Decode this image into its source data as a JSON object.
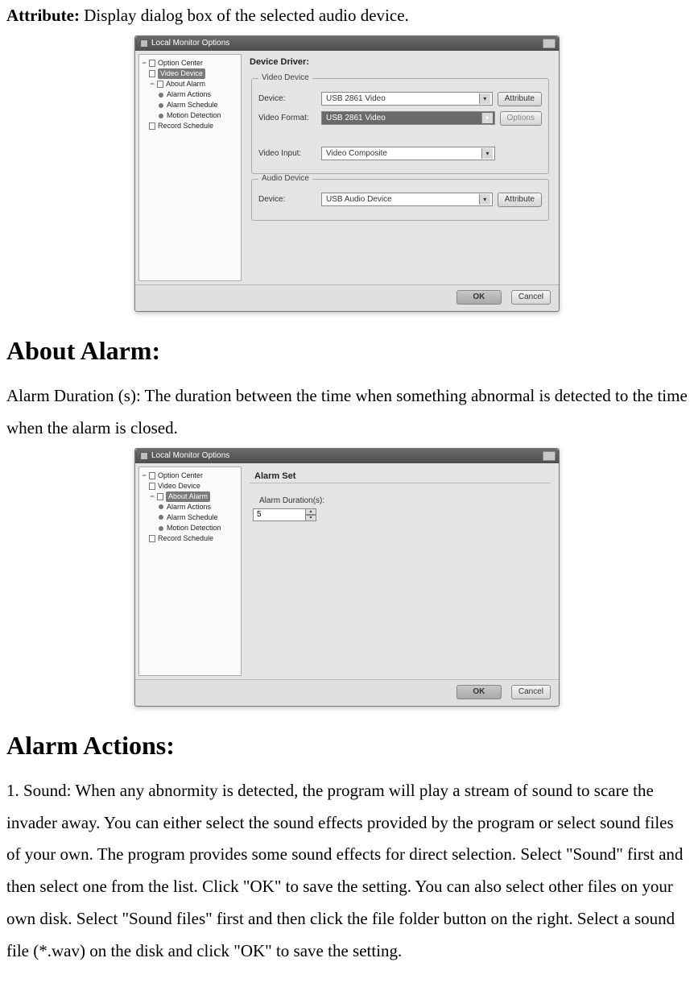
{
  "intro": {
    "attr_label": "Attribute:",
    "attr_desc": " Display dialog box of the selected audio device."
  },
  "shot1": {
    "window_title": "Local Monitor Options",
    "tree": {
      "root": "Option Center",
      "video_device": "Video Device",
      "about_alarm": "About Alarm",
      "alarm_actions": "Alarm Actions",
      "alarm_schedule": "Alarm Schedule",
      "motion_detection": "Motion Detection",
      "record_schedule": "Record Schedule"
    },
    "panel_title": "Device Driver:",
    "video_group": "Video Device",
    "audio_group": "Audio Device",
    "device_label": "Device:",
    "format_label": "Video Format:",
    "input_label": "Video Input:",
    "device_value": "USB 2861 Video",
    "format_value": "USB 2861 Video",
    "input_value": "Video Composite",
    "audio_value": "USB Audio Device",
    "attr_btn": "Attribute",
    "options_btn": "Options",
    "ok": "OK",
    "cancel": "Cancel"
  },
  "about_alarm_heading": "About Alarm:",
  "about_alarm_text": "Alarm Duration (s): The duration between the time when something abnormal is detected to the time when the alarm is closed.",
  "shot2": {
    "window_title": "Local Monitor Options",
    "panel_title": "Alarm Set",
    "duration_label": "Alarm Duration(s):",
    "duration_value": "5",
    "ok": "OK",
    "cancel": "Cancel"
  },
  "alarm_actions_heading": "Alarm Actions:",
  "alarm_actions_text": "1. Sound: When any abnormity is detected, the program will play a stream of sound to scare the invader away. You can either select the sound effects provided by the program or select sound files of your own. The program provides some sound effects for direct selection. Select \"Sound\" first and then select one from the list. Click \"OK\" to save the setting. You can also select other files on your own disk.    Select \"Sound files\" first and then click the file folder button on the right. Select a sound file (*.wav) on the disk and click \"OK\" to save the setting."
}
